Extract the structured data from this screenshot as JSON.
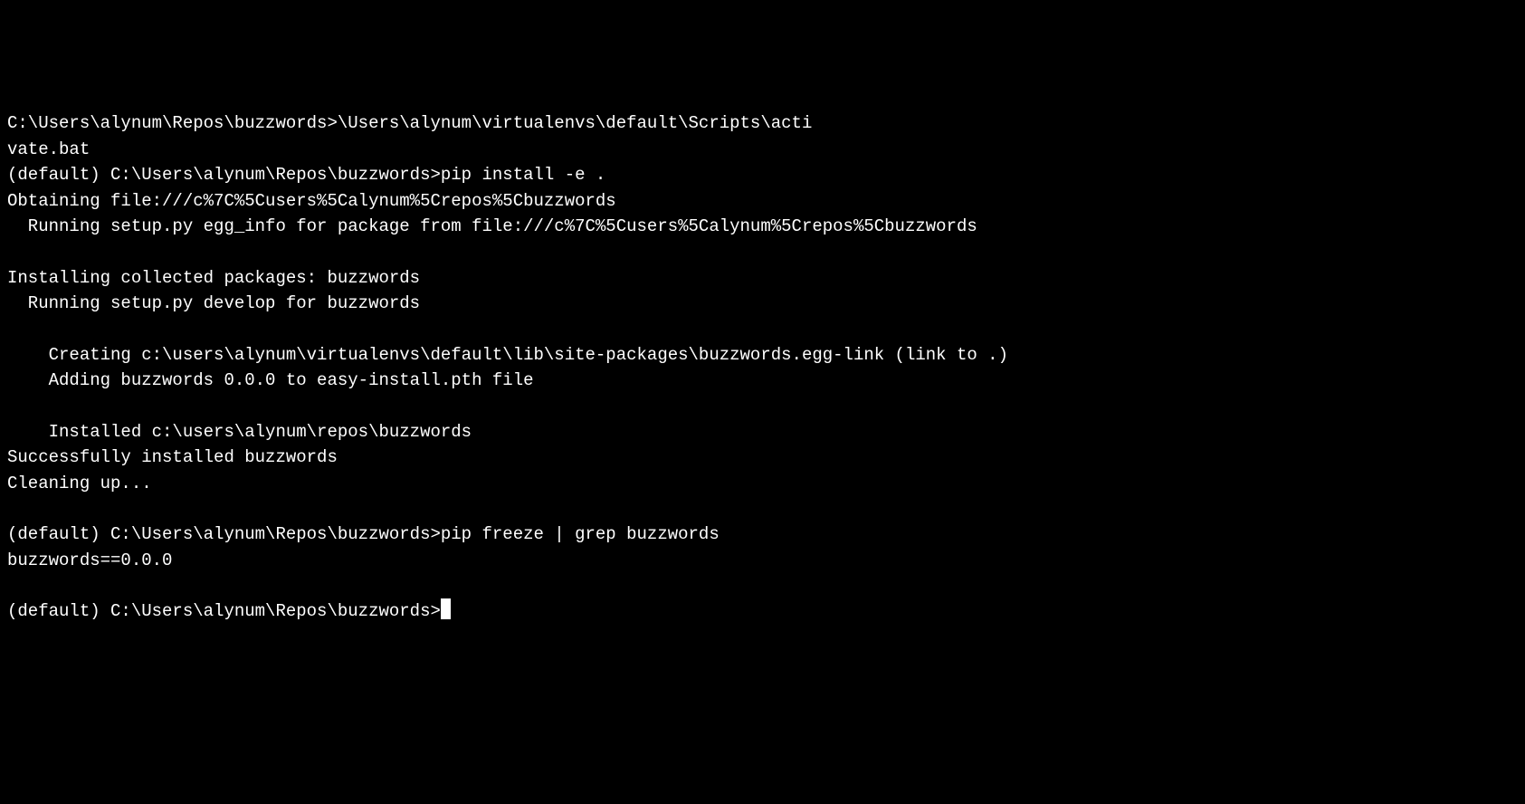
{
  "terminal": {
    "lines": [
      "C:\\Users\\alynum\\Repos\\buzzwords>\\Users\\alynum\\virtualenvs\\default\\Scripts\\acti",
      "vate.bat",
      "(default) C:\\Users\\alynum\\Repos\\buzzwords>pip install -e .",
      "Obtaining file:///c%7C%5Cusers%5Calynum%5Crepos%5Cbuzzwords",
      "  Running setup.py egg_info for package from file:///c%7C%5Cusers%5Calynum%5Crepos%5Cbuzzwords",
      "",
      "Installing collected packages: buzzwords",
      "  Running setup.py develop for buzzwords",
      "",
      "    Creating c:\\users\\alynum\\virtualenvs\\default\\lib\\site-packages\\buzzwords.egg-link (link to .)",
      "    Adding buzzwords 0.0.0 to easy-install.pth file",
      "",
      "    Installed c:\\users\\alynum\\repos\\buzzwords",
      "Successfully installed buzzwords",
      "Cleaning up...",
      "",
      "(default) C:\\Users\\alynum\\Repos\\buzzwords>pip freeze | grep buzzwords",
      "buzzwords==0.0.0",
      "",
      "(default) C:\\Users\\alynum\\Repos\\buzzwords>"
    ],
    "current_prompt": "(default) C:\\Users\\alynum\\Repos\\buzzwords>"
  }
}
